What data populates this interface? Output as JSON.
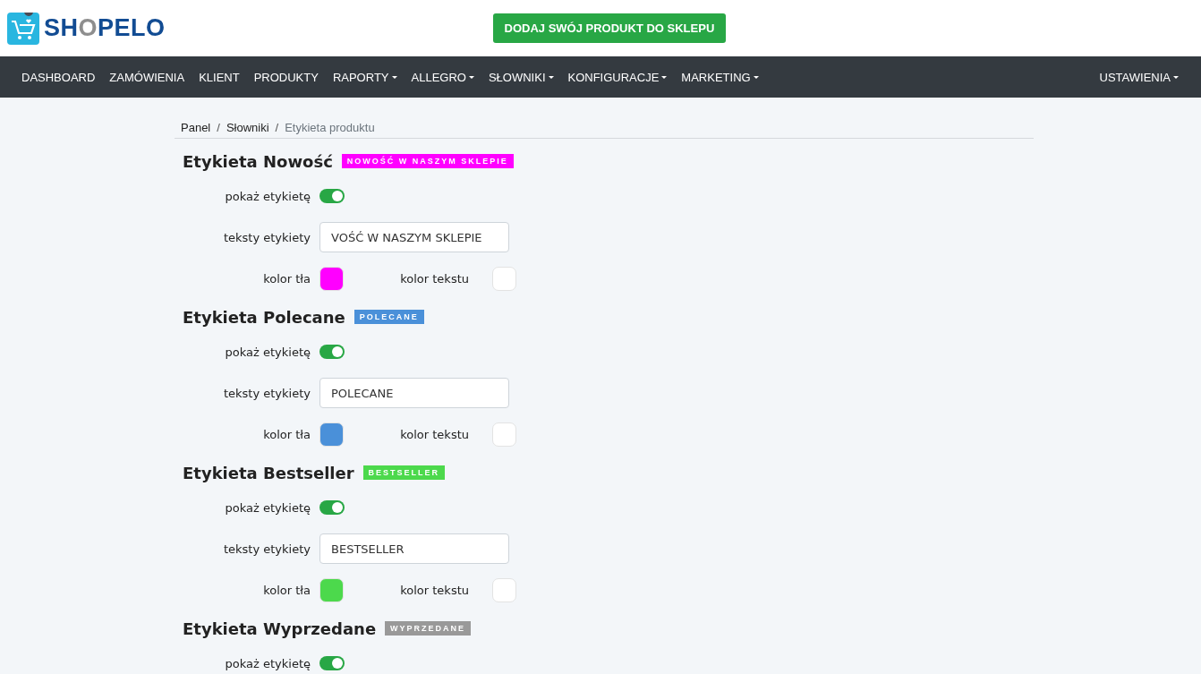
{
  "logo": {
    "text": "SHOPELO"
  },
  "cta_button": "DODAJ SWÓJ PRODUKT DO SKLEPU",
  "nav": {
    "items": [
      {
        "label": "DASHBOARD",
        "dropdown": false
      },
      {
        "label": "ZAMÓWIENIA",
        "dropdown": false
      },
      {
        "label": "KLIENT",
        "dropdown": false
      },
      {
        "label": "PRODUKTY",
        "dropdown": false
      },
      {
        "label": "RAPORTY",
        "dropdown": true
      },
      {
        "label": "ALLEGRO",
        "dropdown": true
      },
      {
        "label": "SŁOWNIKI",
        "dropdown": true
      },
      {
        "label": "KONFIGURACJE",
        "dropdown": true
      },
      {
        "label": "MARKETING",
        "dropdown": true
      }
    ],
    "right": {
      "label": "USTAWIENIA",
      "dropdown": true
    }
  },
  "breadcrumb": {
    "separator": "/",
    "items": [
      {
        "label": "Panel",
        "selected": false
      },
      {
        "label": "Słowniki",
        "selected": false
      },
      {
        "label": "Etykieta produktu",
        "selected": true
      }
    ]
  },
  "sections": [
    {
      "title": "Etykieta Nowość",
      "badge": "NOWOŚĆ W NASZYM SKLEPIE",
      "colors": [
        {
          "kind": "background",
          "color": "#ff00ff"
        },
        {
          "kind": "text",
          "color": "#ffffff"
        }
      ],
      "show_label": "pokaż etykietę",
      "on": true,
      "text_label": "teksty etykiety",
      "text_value": "VOŚĆ W NASZYM SKLEPIE",
      "bg_label": "kolor tła",
      "fg_label": "kolor tekstu"
    },
    {
      "title": "Etykieta Polecane",
      "badge": "POLECANE",
      "colors": [
        {
          "kind": "background",
          "color": "#4a90d9"
        },
        {
          "kind": "text",
          "color": "#ffffff"
        }
      ],
      "show_label": "pokaż etykietę",
      "on": true,
      "text_label": "teksty etykiety",
      "text_value": "POLECANE",
      "bg_label": "kolor tła",
      "fg_label": "kolor tekstu"
    },
    {
      "title": "Etykieta Bestseller",
      "badge": "BESTSELLER",
      "colors": [
        {
          "kind": "background",
          "color": "#4cd94c"
        },
        {
          "kind": "text",
          "color": "#ffffff"
        }
      ],
      "show_label": "pokaż etykietę",
      "on": true,
      "text_label": "teksty etykiety",
      "text_value": "BESTSELLER",
      "bg_label": "kolor tła",
      "fg_label": "kolor tekstu"
    },
    {
      "title": "Etykieta Wyprzedane",
      "badge": "WYPRZEDANE",
      "colors": [
        {
          "kind": "background",
          "color": "#999999"
        }
      ],
      "show_label": "pokaż etykietę",
      "on": true
    }
  ]
}
